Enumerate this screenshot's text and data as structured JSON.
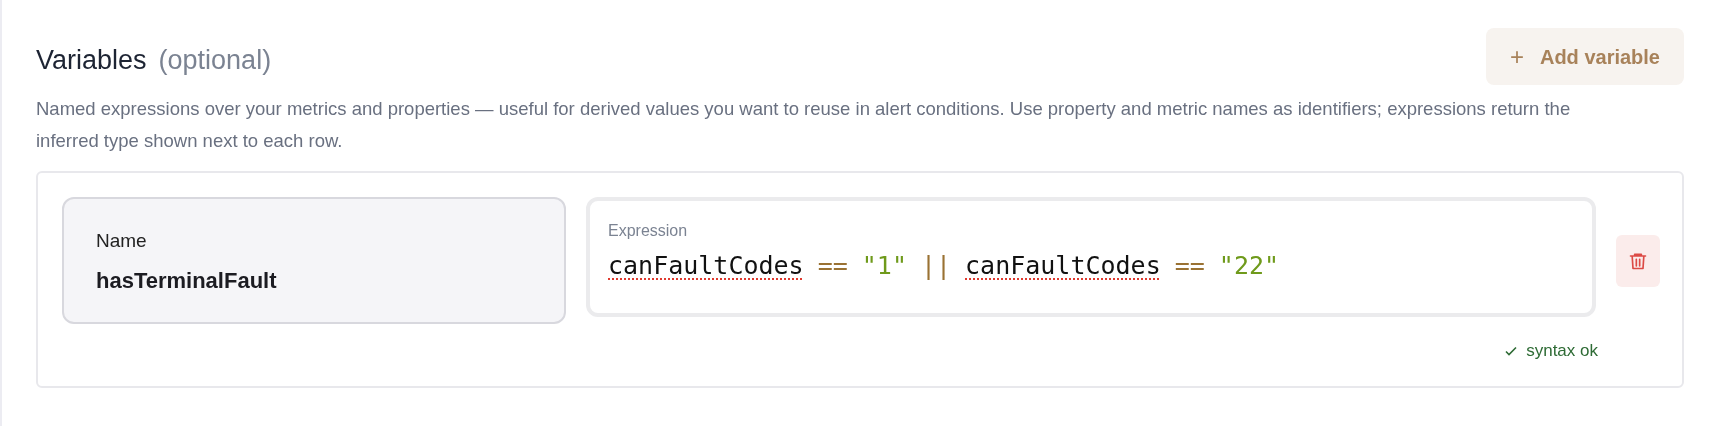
{
  "section": {
    "title": "Variables",
    "subtitle": "(optional)",
    "description": "Named expressions over your metrics and properties — useful for derived values you want to reuse in alert conditions. Use property and metric names as identifiers; expressions return the inferred type shown next to each row."
  },
  "add_button": {
    "icon": "+",
    "label": "Add variable"
  },
  "variables": [
    {
      "name_label": "Name",
      "name": "hasTerminalFault",
      "expression_label": "Expression",
      "tokens": [
        {
          "kind": "ident",
          "text": "canFaultCodes",
          "misspelled": true
        },
        {
          "kind": "op",
          "text": "==",
          "misspelled": false
        },
        {
          "kind": "string",
          "text": "\"1\"",
          "misspelled": false
        },
        {
          "kind": "op",
          "text": "||",
          "misspelled": false
        },
        {
          "kind": "ident",
          "text": "canFaultCodes",
          "misspelled": true
        },
        {
          "kind": "op",
          "text": "==",
          "misspelled": false
        },
        {
          "kind": "string",
          "text": "\"22\"",
          "misspelled": false
        }
      ],
      "status": "syntax ok"
    }
  ]
}
